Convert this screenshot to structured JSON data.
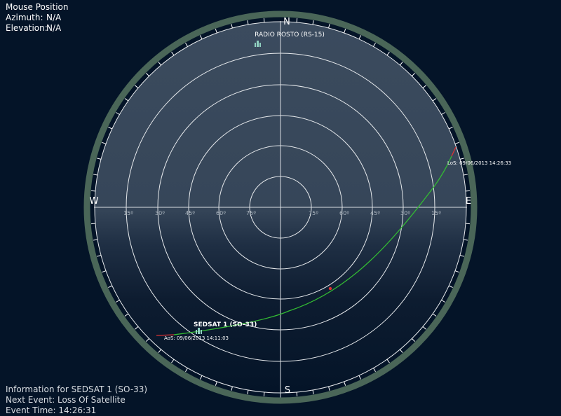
{
  "mouse": {
    "title": "Mouse Position",
    "azimuth_label": "Azimuth:",
    "azimuth_value": "N/A",
    "elevation_label": "Elevation:",
    "elevation_value": "N/A"
  },
  "compass": {
    "north": "N",
    "south": "S",
    "east": "E",
    "west": "W"
  },
  "elevation_labels": [
    "15º",
    "30º",
    "45º",
    "60º",
    "75º"
  ],
  "satellites": {
    "rs15": {
      "name": "RADIO ROSTO (RS-15)",
      "icon": "satellite-icon"
    },
    "so33": {
      "name": "SEDSAT 1 (SO-33)",
      "icon": "satellite-icon"
    }
  },
  "track": {
    "aos": "AoS: 09/06/2013 14:11:03",
    "los": "LoS: 09/06/2013 14:26:33"
  },
  "info": {
    "line1": "Information for SEDSAT 1 (SO-33)",
    "line2": "Next Event: Loss Of Satellite",
    "line3": "Event Time: 14:26:31"
  },
  "colors": {
    "background": "#041428",
    "sky_dome": "#3a4a5e",
    "ring_frame": "#4a6658",
    "pass_track": "#33bb33",
    "track_edge": "#dd3333"
  }
}
